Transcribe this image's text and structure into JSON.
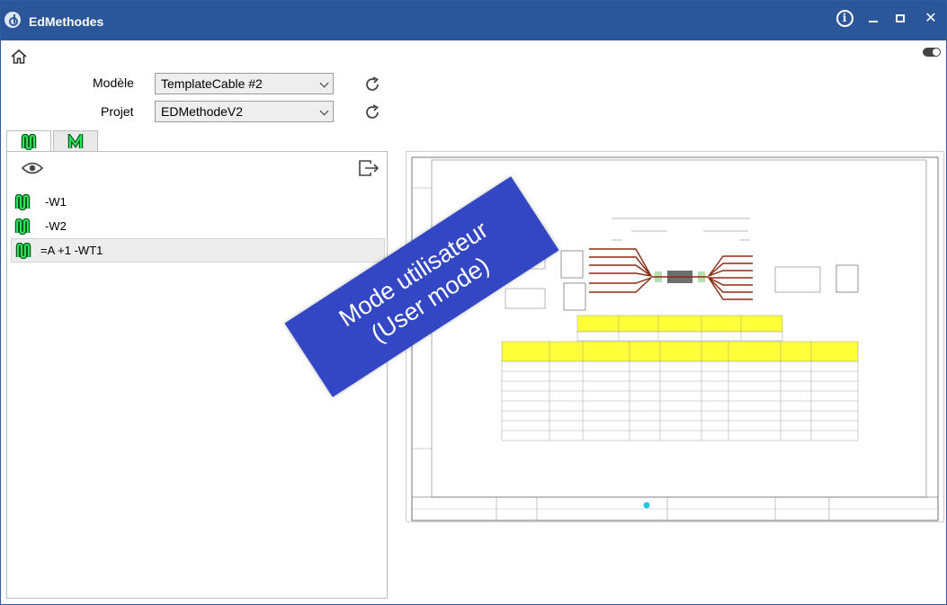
{
  "window": {
    "title": "EdMethodes"
  },
  "titlebar": {
    "close_glyph": "✕",
    "info_glyph": "i"
  },
  "icons": {
    "app": "app-logo-icon",
    "info": "info-icon",
    "minimize": "minimize-icon",
    "maximize": "maximize-icon",
    "close": "close-icon",
    "home": "home-icon",
    "toggle": "toggle-icon",
    "refresh": "refresh-icon",
    "eye": "eye-icon",
    "export": "export-icon",
    "cable": "cable-icon"
  },
  "form": {
    "model_label": "Modèle",
    "model_value": "TemplateCable #2",
    "project_label": "Projet",
    "project_value": "EDMethodeV2"
  },
  "list": {
    "items": [
      {
        "label": "-W1"
      },
      {
        "label": "-W2"
      },
      {
        "label": "=A +1 -WT1"
      }
    ]
  },
  "watermark": {
    "line1": "Mode utilisateur",
    "line2": "(User mode)"
  },
  "colors": {
    "titlebar": "#2b579a",
    "watermark": "#3347c4",
    "cable_icon": "#1fa84a"
  }
}
